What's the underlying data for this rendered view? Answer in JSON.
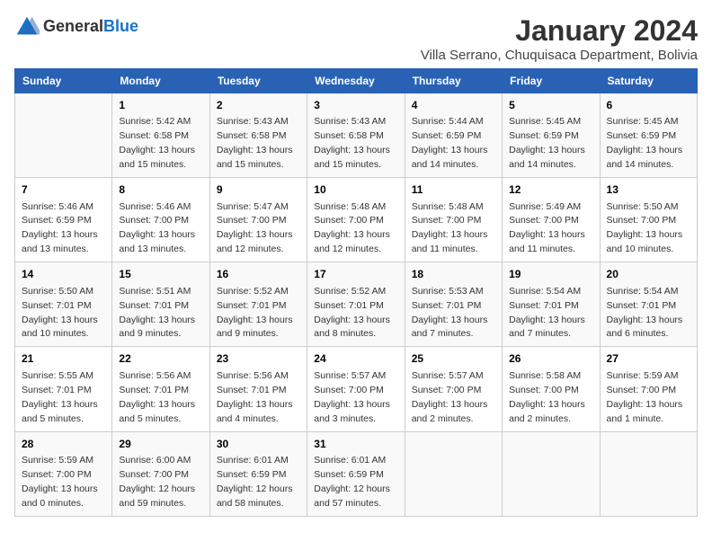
{
  "logo": {
    "general": "General",
    "blue": "Blue"
  },
  "title": "January 2024",
  "subtitle": "Villa Serrano, Chuquisaca Department, Bolivia",
  "days_of_week": [
    "Sunday",
    "Monday",
    "Tuesday",
    "Wednesday",
    "Thursday",
    "Friday",
    "Saturday"
  ],
  "weeks": [
    [
      {
        "day": "",
        "info": ""
      },
      {
        "day": "1",
        "info": "Sunrise: 5:42 AM\nSunset: 6:58 PM\nDaylight: 13 hours\nand 15 minutes."
      },
      {
        "day": "2",
        "info": "Sunrise: 5:43 AM\nSunset: 6:58 PM\nDaylight: 13 hours\nand 15 minutes."
      },
      {
        "day": "3",
        "info": "Sunrise: 5:43 AM\nSunset: 6:58 PM\nDaylight: 13 hours\nand 15 minutes."
      },
      {
        "day": "4",
        "info": "Sunrise: 5:44 AM\nSunset: 6:59 PM\nDaylight: 13 hours\nand 14 minutes."
      },
      {
        "day": "5",
        "info": "Sunrise: 5:45 AM\nSunset: 6:59 PM\nDaylight: 13 hours\nand 14 minutes."
      },
      {
        "day": "6",
        "info": "Sunrise: 5:45 AM\nSunset: 6:59 PM\nDaylight: 13 hours\nand 14 minutes."
      }
    ],
    [
      {
        "day": "7",
        "info": "Sunrise: 5:46 AM\nSunset: 6:59 PM\nDaylight: 13 hours\nand 13 minutes."
      },
      {
        "day": "8",
        "info": "Sunrise: 5:46 AM\nSunset: 7:00 PM\nDaylight: 13 hours\nand 13 minutes."
      },
      {
        "day": "9",
        "info": "Sunrise: 5:47 AM\nSunset: 7:00 PM\nDaylight: 13 hours\nand 12 minutes."
      },
      {
        "day": "10",
        "info": "Sunrise: 5:48 AM\nSunset: 7:00 PM\nDaylight: 13 hours\nand 12 minutes."
      },
      {
        "day": "11",
        "info": "Sunrise: 5:48 AM\nSunset: 7:00 PM\nDaylight: 13 hours\nand 11 minutes."
      },
      {
        "day": "12",
        "info": "Sunrise: 5:49 AM\nSunset: 7:00 PM\nDaylight: 13 hours\nand 11 minutes."
      },
      {
        "day": "13",
        "info": "Sunrise: 5:50 AM\nSunset: 7:00 PM\nDaylight: 13 hours\nand 10 minutes."
      }
    ],
    [
      {
        "day": "14",
        "info": "Sunrise: 5:50 AM\nSunset: 7:01 PM\nDaylight: 13 hours\nand 10 minutes."
      },
      {
        "day": "15",
        "info": "Sunrise: 5:51 AM\nSunset: 7:01 PM\nDaylight: 13 hours\nand 9 minutes."
      },
      {
        "day": "16",
        "info": "Sunrise: 5:52 AM\nSunset: 7:01 PM\nDaylight: 13 hours\nand 9 minutes."
      },
      {
        "day": "17",
        "info": "Sunrise: 5:52 AM\nSunset: 7:01 PM\nDaylight: 13 hours\nand 8 minutes."
      },
      {
        "day": "18",
        "info": "Sunrise: 5:53 AM\nSunset: 7:01 PM\nDaylight: 13 hours\nand 7 minutes."
      },
      {
        "day": "19",
        "info": "Sunrise: 5:54 AM\nSunset: 7:01 PM\nDaylight: 13 hours\nand 7 minutes."
      },
      {
        "day": "20",
        "info": "Sunrise: 5:54 AM\nSunset: 7:01 PM\nDaylight: 13 hours\nand 6 minutes."
      }
    ],
    [
      {
        "day": "21",
        "info": "Sunrise: 5:55 AM\nSunset: 7:01 PM\nDaylight: 13 hours\nand 5 minutes."
      },
      {
        "day": "22",
        "info": "Sunrise: 5:56 AM\nSunset: 7:01 PM\nDaylight: 13 hours\nand 5 minutes."
      },
      {
        "day": "23",
        "info": "Sunrise: 5:56 AM\nSunset: 7:01 PM\nDaylight: 13 hours\nand 4 minutes."
      },
      {
        "day": "24",
        "info": "Sunrise: 5:57 AM\nSunset: 7:00 PM\nDaylight: 13 hours\nand 3 minutes."
      },
      {
        "day": "25",
        "info": "Sunrise: 5:57 AM\nSunset: 7:00 PM\nDaylight: 13 hours\nand 2 minutes."
      },
      {
        "day": "26",
        "info": "Sunrise: 5:58 AM\nSunset: 7:00 PM\nDaylight: 13 hours\nand 2 minutes."
      },
      {
        "day": "27",
        "info": "Sunrise: 5:59 AM\nSunset: 7:00 PM\nDaylight: 13 hours\nand 1 minute."
      }
    ],
    [
      {
        "day": "28",
        "info": "Sunrise: 5:59 AM\nSunset: 7:00 PM\nDaylight: 13 hours\nand 0 minutes."
      },
      {
        "day": "29",
        "info": "Sunrise: 6:00 AM\nSunset: 7:00 PM\nDaylight: 12 hours\nand 59 minutes."
      },
      {
        "day": "30",
        "info": "Sunrise: 6:01 AM\nSunset: 6:59 PM\nDaylight: 12 hours\nand 58 minutes."
      },
      {
        "day": "31",
        "info": "Sunrise: 6:01 AM\nSunset: 6:59 PM\nDaylight: 12 hours\nand 57 minutes."
      },
      {
        "day": "",
        "info": ""
      },
      {
        "day": "",
        "info": ""
      },
      {
        "day": "",
        "info": ""
      }
    ]
  ]
}
